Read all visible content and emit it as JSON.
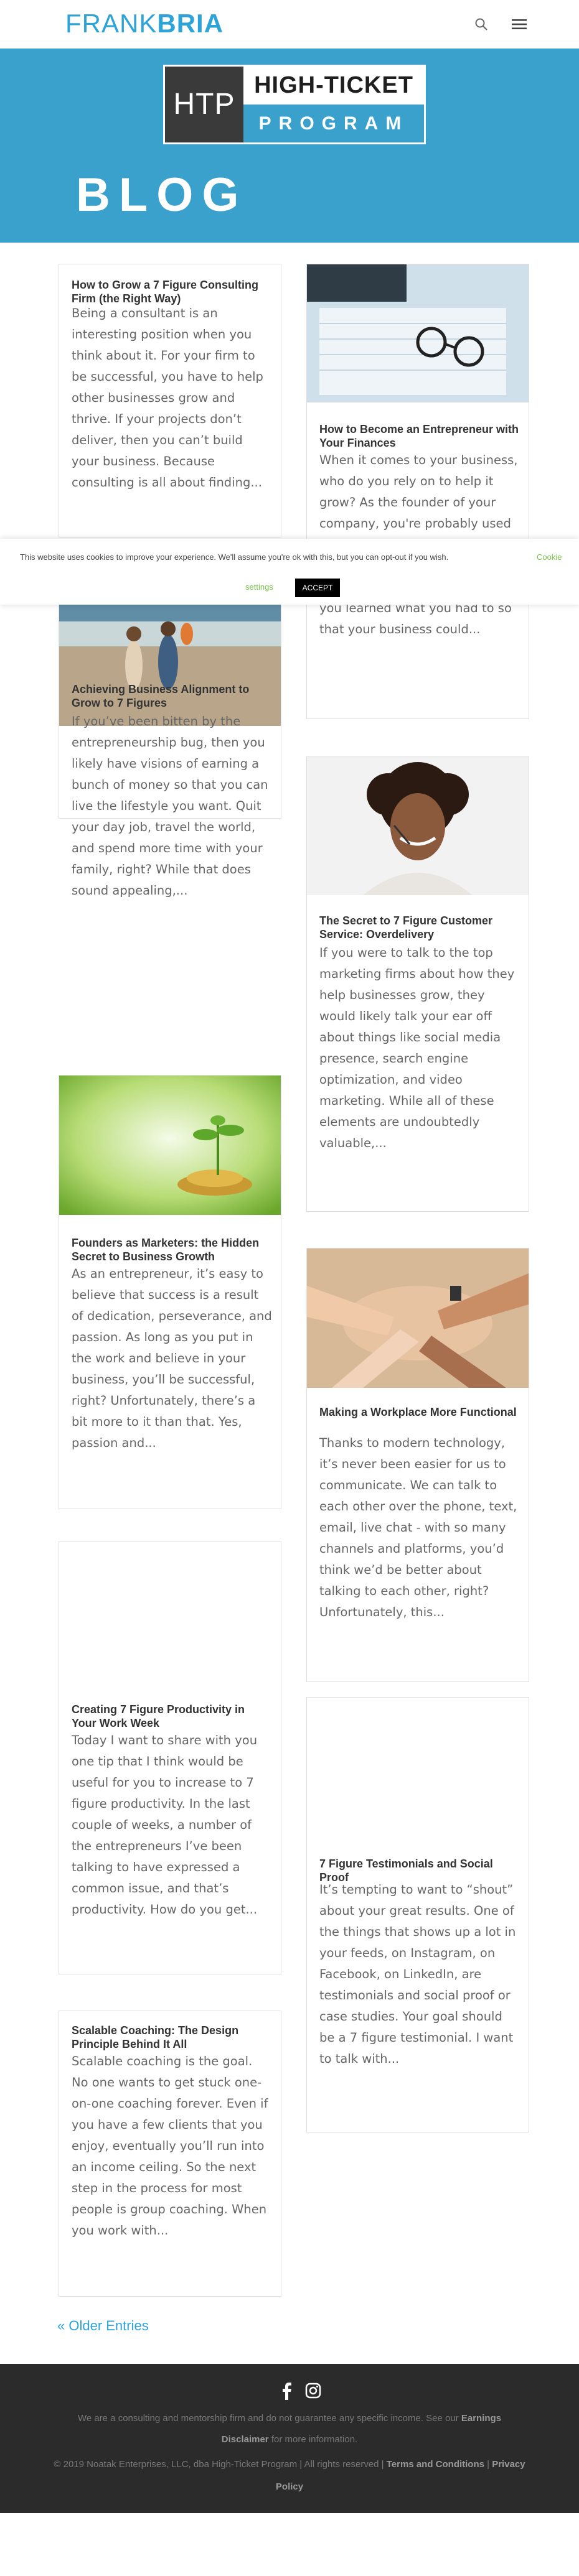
{
  "header": {
    "logo_light": "FRANK",
    "logo_bold": "BRIA",
    "brand_color": "#2ea3d8",
    "search_icon": "search-icon",
    "menu_icon": "hamburger-menu-icon"
  },
  "hero": {
    "badge_left": "HTP",
    "badge_top": "HIGH-TICKET",
    "badge_bottom": "PROGRAM",
    "title": "BLOG",
    "background": "#3aa0cc"
  },
  "posts": [
    {
      "title": "How to Grow a 7 Figure Consulting Firm (the Right Way)",
      "excerpt": "Being a consultant is an interesting position when you think about it. For your firm to be successful, you have to help other businesses grow and thrive. If your projects don’t deliver, then you can’t build your business. Because consulting is all about finding...",
      "image": ""
    },
    {
      "title": "How to Become an Entrepreneur with Your Finances",
      "excerpt": "When it comes to your business, who do you rely on to help it grow? As the founder of your company, you're probably used to doing everything on your own. Even if you didn't know what you were doing at first, you learned what you had to so that your business could...",
      "image": "glasses-on-financial-papers"
    },
    {
      "title": "Achieving Business Alignment to Grow to 7 Figures",
      "excerpt": "If you’ve been bitten by the entrepreneurship bug, then you likely have visions of earning a bunch of money so that you can live the lifestyle you want. Quit your day job, travel the world, and spend more time with your family, right? While that does sound appealing,...",
      "image": "family-walking-on-beach"
    },
    {
      "title": "The Secret to 7 Figure Customer Service: Overdelivery",
      "excerpt": "If you were to talk to the top marketing firms about how they help businesses grow, they would likely talk your ear off about things like social media presence, search engine optimization, and video marketing. While all of these elements are undoubtedly valuable,...",
      "image": "smiling-support-agent-headset"
    },
    {
      "title": "Founders as Marketers: the Hidden Secret to Business Growth",
      "excerpt": "As an entrepreneur, it’s easy to believe that success is a result of dedication, perseverance, and passion. As long as you put in the work and believe in your business, you’ll be successful, right? Unfortunately, there’s a bit more to it than that. Yes, passion and...",
      "image": "plant-growing-from-coins"
    },
    {
      "title": "Making a Workplace More Functional",
      "excerpt": "Thanks to modern technology, it’s never been easier for us to communicate. We can talk to each other over the phone, text, email, live chat - with so many channels and platforms, you’d think we’d be better about talking to each other, right? Unfortunately, this...",
      "image": "team-hands-stacked"
    },
    {
      "title": "Creating 7 Figure Productivity in Your Work Week",
      "excerpt": "Today I want to share with you one tip that I think would be useful for you to increase to 7 figure productivity. In the last couple of weeks, a number of the entrepreneurs I’ve been talking to have expressed a common issue, and that’s productivity. How do you get...",
      "image": ""
    },
    {
      "title": "7 Figure Testimonials and Social Proof",
      "excerpt": "It’s tempting to want to “shout” about your great results. One of the things that shows up a lot in your feeds, on Instagram, on Facebook, on LinkedIn, are testimonials and social proof or case studies. Your goal should be a 7 figure testimonial. I want to talk with...",
      "image": ""
    },
    {
      "title": "Scalable Coaching: The Design Principle Behind It All",
      "excerpt": "Scalable coaching is the goal. No one wants to get stuck one-on-one coaching forever. Even if you have a few clients that you enjoy, eventually you’ll run into an income ceiling. So the next step in the process for most people is group coaching. When you work with...",
      "image": ""
    }
  ],
  "cookie": {
    "text": "This website uses cookies to improve your experience. We'll assume you're ok with this, but you can opt-out if you wish.",
    "link_part1": "Cookie",
    "link_part2": "settings",
    "accept": "ACCEPT",
    "link_color": "#7cc24d"
  },
  "older_entries": "« Older Entries",
  "footer": {
    "social": [
      "facebook-icon",
      "instagram-icon"
    ],
    "disclaimer_text": "We are a consulting and mentorship firm and do not guarantee any specific income. See our ",
    "earnings_link": "Earnings",
    "disclaimer_link": "Disclaimer",
    "disclaimer_suffix": " for more information.",
    "copyright": "© 2019 Noatak Enterprises, LLC, dba High-Ticket Program  |  All rights reserved  |  ",
    "terms": "Terms and Conditions",
    "sep": "  |  ",
    "privacy": "Privacy",
    "policy": "Policy"
  }
}
